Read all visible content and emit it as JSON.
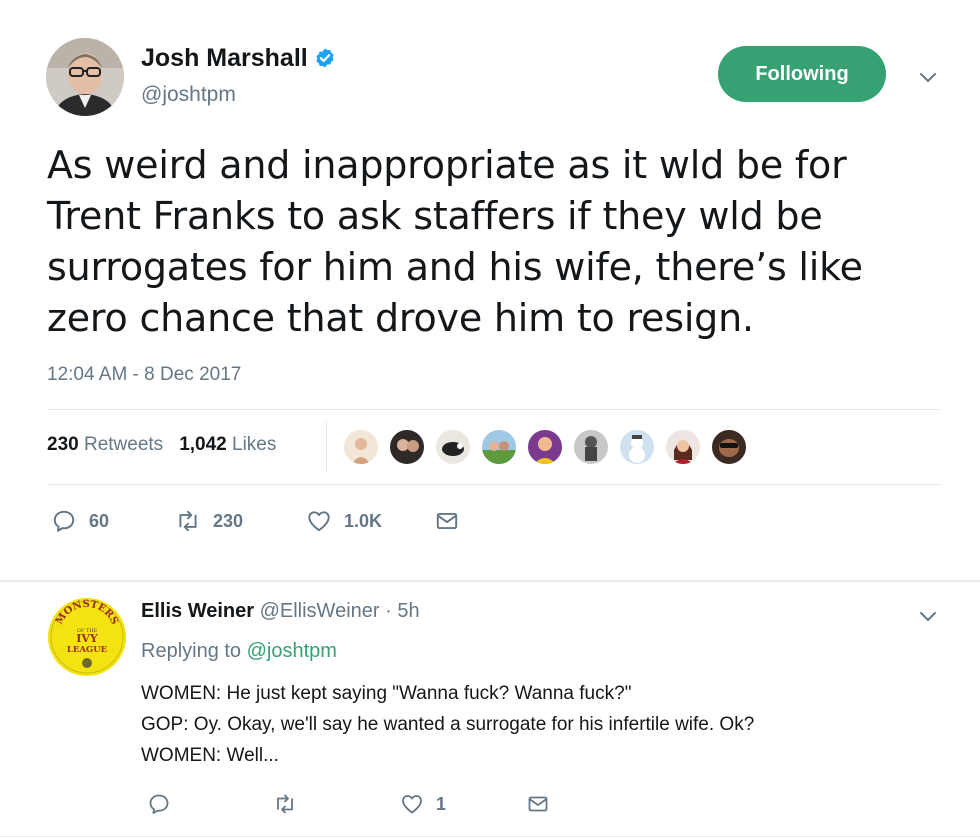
{
  "tweet": {
    "author_name": "Josh Marshall",
    "author_handle": "@joshtpm",
    "follow_label": "Following",
    "text": "As weird and inappropriate as it wld be for\nTrent Franks to ask staffers if they wld be\nsurrogates for him and his wife, there’s like\nzero chance that drove him to resign.",
    "timestamp": "12:04 AM - 8 Dec 2017",
    "retweets_count": "230",
    "retweets_label": "Retweets",
    "likes_count": "1,042",
    "likes_label": "Likes",
    "actions": {
      "replies": "60",
      "retweets": "230",
      "likes": "1.0K"
    }
  },
  "reply": {
    "author_name": "Ellis Weiner",
    "author_handle": "@EllisWeiner",
    "separator": "·",
    "time": "5h",
    "replying_prefix": "Replying to",
    "replying_to": "@joshtpm",
    "text": "WOMEN: He just kept saying \"Wanna fuck? Wanna fuck?\"\nGOP: Oy. Okay, we'll say he wanted a surrogate for his infertile wife. Ok?\nWOMEN: Well...",
    "avatar_text": [
      "MONSTERS",
      "OF THE",
      "IVY",
      "LEAGUE"
    ],
    "actions": {
      "likes": "1"
    }
  },
  "colors": {
    "accent": "#36a172",
    "verified": "#1da1f2",
    "muted": "#657786",
    "text": "#14171a"
  },
  "icons": [
    "verified-badge-icon",
    "chevron-down-icon",
    "reply-icon",
    "retweet-icon",
    "heart-icon",
    "message-icon"
  ]
}
